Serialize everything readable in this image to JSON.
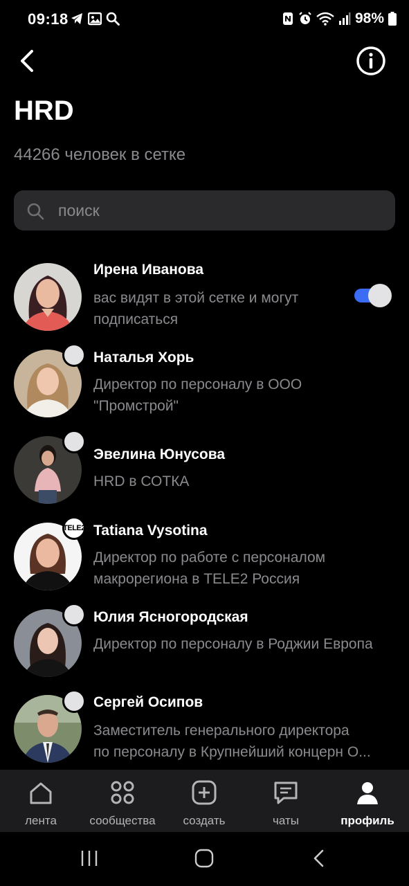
{
  "status_bar": {
    "time": "09:18",
    "battery": "98%",
    "left_icons": [
      "telegram-icon",
      "image-icon",
      "search-icon"
    ],
    "right_icons": [
      "nfc-icon",
      "alarm-icon",
      "wifi-icon",
      "signal-icon",
      "battery-icon"
    ]
  },
  "header": {
    "back_icon": "chevron-left-icon",
    "info_icon": "info-icon"
  },
  "group": {
    "title": "HRD",
    "members_count": "44266 человек в сетке"
  },
  "search": {
    "placeholder": "поиск",
    "value": ""
  },
  "members": [
    {
      "name": "Ирена Иванова",
      "description": "вас видят в этой сетке и могут подписаться",
      "toggle_on": true
    },
    {
      "name": "Наталья Хорь",
      "description": "Директор по персоналу в ООО \"Промстрой\""
    },
    {
      "name": "Эвелина Юнусова",
      "description": "HRD в СОТКА"
    },
    {
      "name": "Tatiana Vysotina",
      "description": "Директор по работе с персоналом макрорегиона в TELE2 Россия",
      "badge": "TELE2"
    },
    {
      "name": "Юлия Ясногородская",
      "description": "Директор по персоналу в Роджии Европа"
    },
    {
      "name": "Сергей Осипов",
      "description_line1": "Заместитель генерального директора",
      "description_line2": "по персоналу в Крупнейший концерн О..."
    }
  ],
  "bottom_nav": {
    "items": [
      {
        "label": "лента",
        "icon": "home-icon"
      },
      {
        "label": "сообщества",
        "icon": "grid-icon"
      },
      {
        "label": "создать",
        "icon": "plus-square-icon"
      },
      {
        "label": "чаты",
        "icon": "chat-icon"
      },
      {
        "label": "профиль",
        "icon": "user-icon",
        "active": true
      }
    ]
  },
  "colors": {
    "background": "#000000",
    "accent": "#3b6cf5",
    "secondary_text": "#8a8a8e",
    "surface": "#2a2a2c",
    "nav_background": "#1c1c1e"
  }
}
